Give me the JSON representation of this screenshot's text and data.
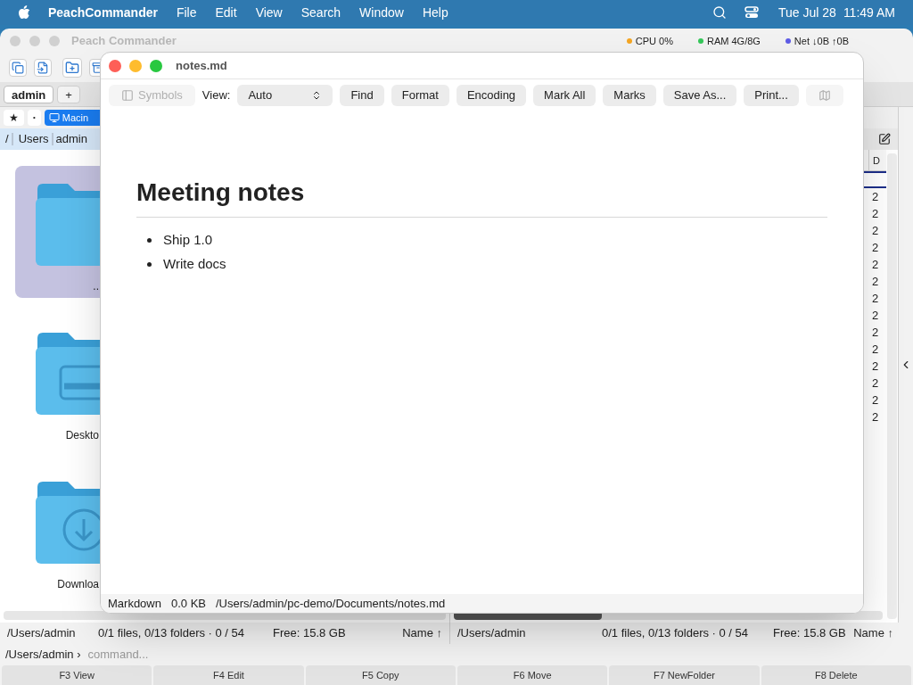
{
  "menu_bar": {
    "app_name": "PeachCommander",
    "menus": [
      "File",
      "Edit",
      "View",
      "Search",
      "Window",
      "Help"
    ],
    "date": "Tue Jul 28",
    "time": "11:49 AM"
  },
  "main_window": {
    "title": "Peach Commander",
    "stats": [
      {
        "label": "CPU 0%",
        "color": "#f5a623"
      },
      {
        "label": "RAM 4G/8G",
        "color": "#34c759"
      },
      {
        "label": "Net ↓0B ↑0B",
        "color": "#5e5ce6"
      }
    ]
  },
  "tabs": [
    {
      "label": "admin",
      "selected": true
    },
    {
      "label": "+",
      "selected": false
    }
  ],
  "left_panel": {
    "bookmarks": [
      {
        "kind": "star",
        "label": "★"
      },
      {
        "kind": "more",
        "label": "•"
      },
      {
        "kind": "drive",
        "label": "Macin"
      }
    ],
    "breadcrumb": [
      "/",
      "Users",
      "admin"
    ],
    "items": [
      {
        "label": "..",
        "kind": "folder",
        "selected": true
      },
      {
        "label": "Deskto",
        "kind": "desktop",
        "selected": false
      },
      {
        "label": "Downloa",
        "kind": "downloads",
        "selected": false
      }
    ]
  },
  "right_panel": {
    "column_header": "D",
    "rows": [
      {
        "selected": true
      },
      {
        "selected": false,
        "cell": "2"
      },
      {
        "selected": false,
        "cell": "2"
      },
      {
        "selected": false,
        "cell": "2"
      },
      {
        "selected": false,
        "cell": "2"
      },
      {
        "selected": false,
        "cell": "2"
      },
      {
        "selected": false,
        "cell": "2"
      },
      {
        "selected": false,
        "cell": "2"
      },
      {
        "selected": false,
        "cell": "2"
      },
      {
        "selected": false,
        "cell": "2"
      },
      {
        "selected": false,
        "cell": "2"
      },
      {
        "selected": false,
        "cell": "2"
      },
      {
        "selected": false,
        "cell": "2"
      },
      {
        "selected": false,
        "cell": "2"
      },
      {
        "selected": false,
        "cell": "2"
      }
    ]
  },
  "status_bars": [
    {
      "path": "/Users/admin",
      "counts": "0/1 files, 0/13 folders · 0 / 54",
      "free": "Free: 15.8 GB",
      "sort": "Name ↑"
    },
    {
      "path": "/Users/admin",
      "counts": "0/1 files, 0/13 folders · 0 / 54",
      "free": "Free: 15.8 GB",
      "sort": "Name ↑"
    }
  ],
  "command_line": {
    "prompt": "/Users/admin ›",
    "placeholder": "command..."
  },
  "function_keys": [
    "F3 View",
    "F4 Edit",
    "F5 Copy",
    "F6 Move",
    "F7 NewFolder",
    "F8 Delete"
  ],
  "editor": {
    "title": "notes.md",
    "symbols_button": {
      "label": "Symbols",
      "disabled": true
    },
    "view_label": "View:",
    "view_value": "Auto",
    "buttons": [
      "Find",
      "Format",
      "Encoding",
      "Mark All",
      "Marks",
      "Save As...",
      "Print..."
    ],
    "heading": "Meeting notes",
    "bullets": [
      "Ship 1.0",
      "Write docs"
    ],
    "status_bar": {
      "format": "Markdown",
      "size": "0.0 KB",
      "path": "/Users/admin/pc-demo/Documents/notes.md"
    }
  }
}
